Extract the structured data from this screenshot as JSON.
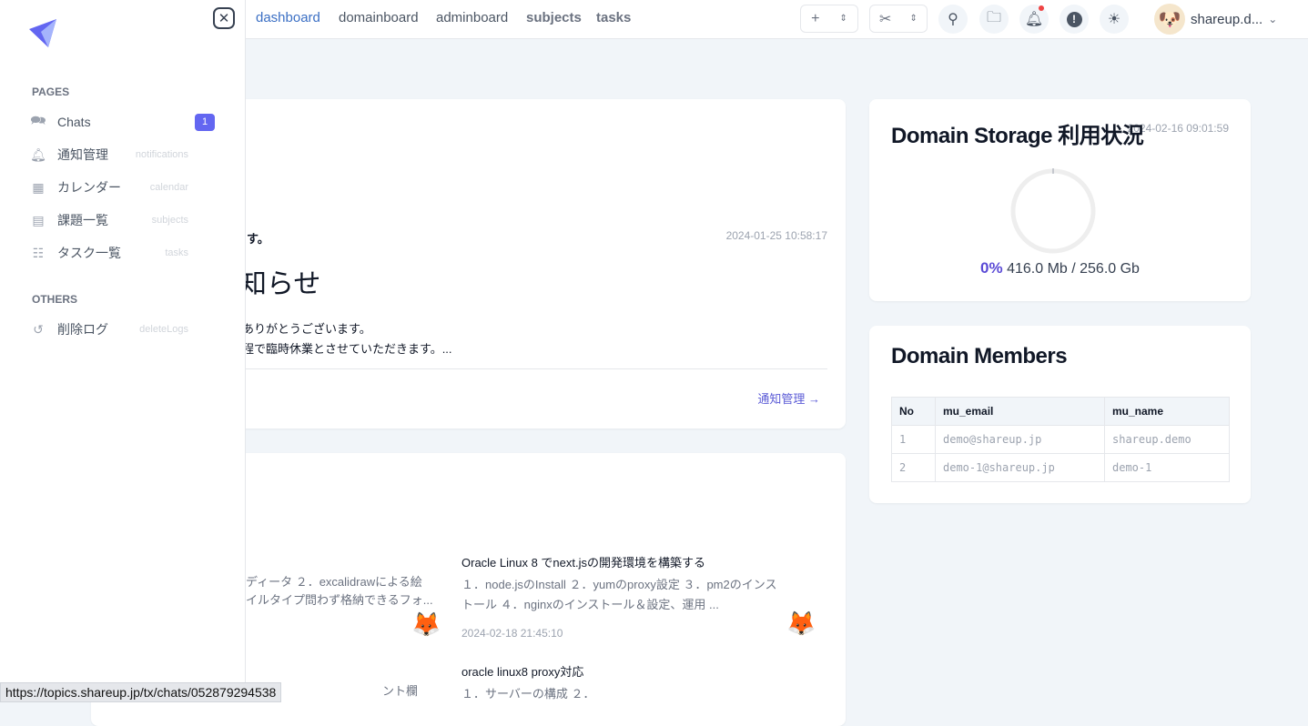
{
  "nav": {
    "items": [
      "dashboard",
      "domainboard",
      "adminboard",
      "subjects",
      "tasks"
    ],
    "active": "dashboard"
  },
  "header": {
    "add_icon": "+",
    "user_name": "shareup.d...",
    "notification_dot_color": "#ef4444"
  },
  "sidebar": {
    "pages_label": "PAGES",
    "others_label": "OTHERS",
    "items": [
      {
        "label": "Chats",
        "badge": "1",
        "icon": "chat-icon"
      },
      {
        "label": "通知管理",
        "hint": "notifications",
        "icon": "bell-icon"
      },
      {
        "label": "カレンダー",
        "hint": "calendar",
        "icon": "calendar-icon"
      },
      {
        "label": "課題一覧",
        "hint": "subjects",
        "icon": "message-icon"
      },
      {
        "label": "タスク一覧",
        "hint": "tasks",
        "icon": "list-check-icon"
      }
    ],
    "others": [
      {
        "label": "削除ログ",
        "hint": "deleteLogs",
        "icon": "history-icon"
      }
    ]
  },
  "notice": {
    "subtitle": "ます。",
    "date": "2024-01-25 10:58:17",
    "title": "知らせ",
    "line1": "ありがとうございます。",
    "line2": "程で臨時休業とさせていただきます。...",
    "link": "通知管理 →"
  },
  "topics": {
    "left": {
      "line1": "ディータ ２．excalidrawによる絵",
      "line2": "イルタイプ問わず格納できるフォ...",
      "next_fragment": "ント欄"
    },
    "items": [
      {
        "title": "Oracle Linux 8 でnext.jsの開発環境を構築する",
        "line1": "１．node.jsのInstall ２．yumのproxy設定 ３．pm2のインス",
        "line2": "トール ４．nginxのインストール＆設定、運用 ...",
        "date": "2024-02-18 21:45:10"
      },
      {
        "title": "oracle linux8 proxy対応",
        "line1": "１．サーバーの構成 ２．"
      }
    ]
  },
  "storage": {
    "title": "Domain Storage 利用状況",
    "date": "2024-02-16 09:01:59",
    "percent": "0%",
    "usage": "416.0 Mb / 256.0 Gb",
    "accent": "#5b4bd6"
  },
  "members": {
    "title": "Domain Members",
    "columns": [
      "No",
      "mu_email",
      "mu_name"
    ],
    "rows": [
      [
        "1",
        "demo@shareup.jp",
        "shareup.demo"
      ],
      [
        "2",
        "demo-1@shareup.jp",
        "demo-1"
      ]
    ]
  },
  "statusbar": {
    "url": "https://topics.shareup.jp/tx/chats/052879294538"
  }
}
